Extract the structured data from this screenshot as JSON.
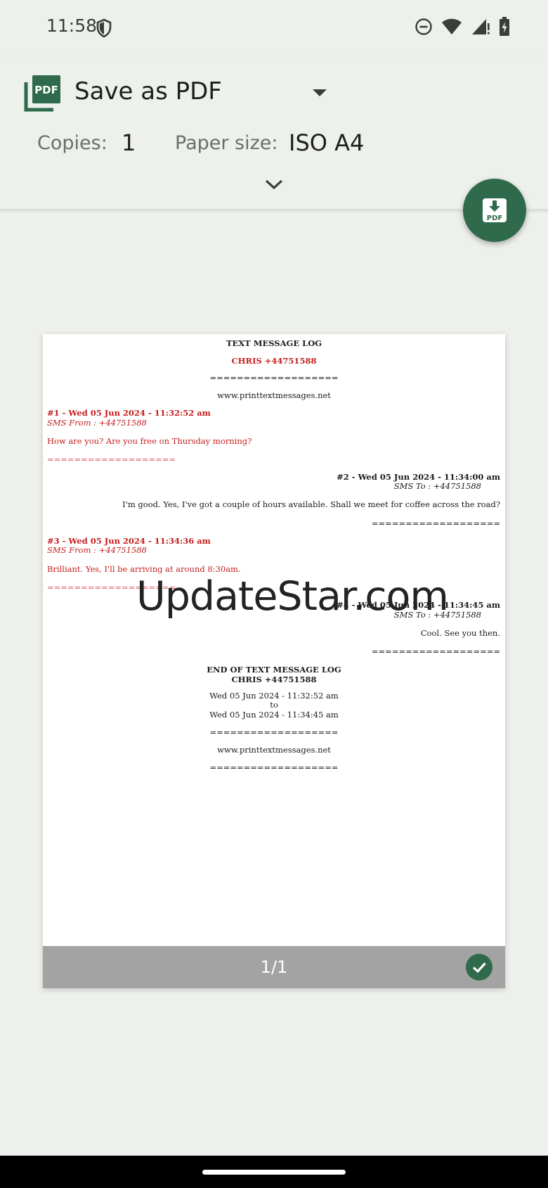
{
  "status_bar": {
    "time": "11:58"
  },
  "header": {
    "printer_name": "Save as PDF",
    "copies_label": "Copies:",
    "copies_value": "1",
    "paper_size_label": "Paper size:",
    "paper_size_value": "ISO A4"
  },
  "fab": {
    "icon": "pdf-download-icon",
    "label": "PDF"
  },
  "pdf_icon_label": "PDF",
  "preview": {
    "title": "TEXT MESSAGE LOG",
    "contact": "CHRIS +44751588",
    "rule": "===================",
    "website": "www.printtextmessages.net",
    "messages": [
      {
        "header": "#1 - Wed 05 Jun 2024 - 11:32:52 am",
        "direction": "SMS From : +44751588",
        "body": "How are you? Are you free on Thursday morning?"
      },
      {
        "header": "#2 - Wed 05 Jun 2024 - 11:34:00 am",
        "direction": "SMS To : +44751588",
        "body": "I'm good. Yes, I've got a couple of hours available. Shall we meet for coffee across the road?"
      },
      {
        "header": "#3 - Wed 05 Jun 2024 - 11:34:36 am",
        "direction": "SMS From : +44751588",
        "body": "Brilliant. Yes, I'll be arriving at around 8:30am."
      },
      {
        "header": "#4 - Wed 05 Jun 2024 - 11:34:45 am",
        "direction": "SMS To : +44751588",
        "body": "Cool. See you then."
      }
    ],
    "end_title": "END OF TEXT MESSAGE LOG",
    "end_contact": "CHRIS +44751588",
    "range_start": "Wed 05 Jun 2024 - 11:32:52 am",
    "range_to": "to",
    "range_end": "Wed 05 Jun 2024 - 11:34:45 am",
    "page_counter": "1/1"
  },
  "watermark": "UpdateStar.com",
  "colors": {
    "accent": "#2f6a4c",
    "incoming_text": "#c51c1c",
    "background": "#eef0ec"
  }
}
